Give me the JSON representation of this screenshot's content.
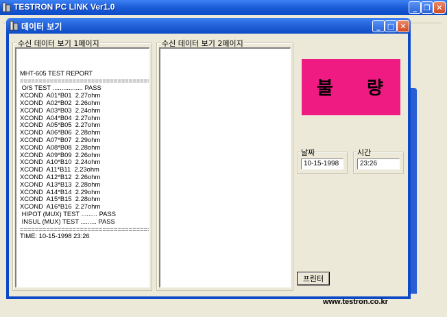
{
  "main_window": {
    "title": "TESTRON PC LINK Ver1.0",
    "buttons": {
      "minimize": "_",
      "maximize": "❐",
      "close": "✕"
    }
  },
  "child_window": {
    "title": "데이터 보기",
    "buttons": {
      "minimize": "_",
      "maximize": "□",
      "close": "✕"
    }
  },
  "page1": {
    "legend": "수신 데이터 보기 1페이지",
    "lines": [
      "",
      "MHT-605 TEST REPORT",
      "=====================================",
      " O/S TEST ................. PASS",
      "XCOND  A01*B01  2.27ohm",
      "XCOND  A02*B02  2.26ohm",
      "XCOND  A03*B03  2.24ohm",
      "XCOND  A04*B04  2.27ohm",
      "XCOND  A05*B05  2.27ohm",
      "XCOND  A06*B06  2.28ohm",
      "XCOND  A07*B07  2.29ohm",
      "XCOND  A08*B08  2.28ohm",
      "XCOND  A09*B09  2.26ohm",
      "XCOND  A10*B10  2.24ohm",
      "XCOND  A11*B11  2.23ohm",
      "XCOND  A12*B12  2.26ohm",
      "XCOND  A13*B13  2.28ohm",
      "XCOND  A14*B14  2.29ohm",
      "XCOND  A15*B15  2.28ohm",
      "XCOND  A16*B16  2.27ohm",
      " HIPOT (MUX) TEST ......... PASS",
      " INSUL (MUX) TEST ......... PASS",
      "=====================================",
      "TIME: 10-15-1998 23:26"
    ]
  },
  "page2": {
    "legend": "수신 데이터 보기 2페이지"
  },
  "status": {
    "char1": "불",
    "char2": "량",
    "color": "#ef1a82"
  },
  "date": {
    "label": "날짜",
    "value": "10-15-1998"
  },
  "time": {
    "label": "시간",
    "value": "23:26"
  },
  "print_button": {
    "label": "프린터"
  },
  "website": "www.testron.co.kr"
}
